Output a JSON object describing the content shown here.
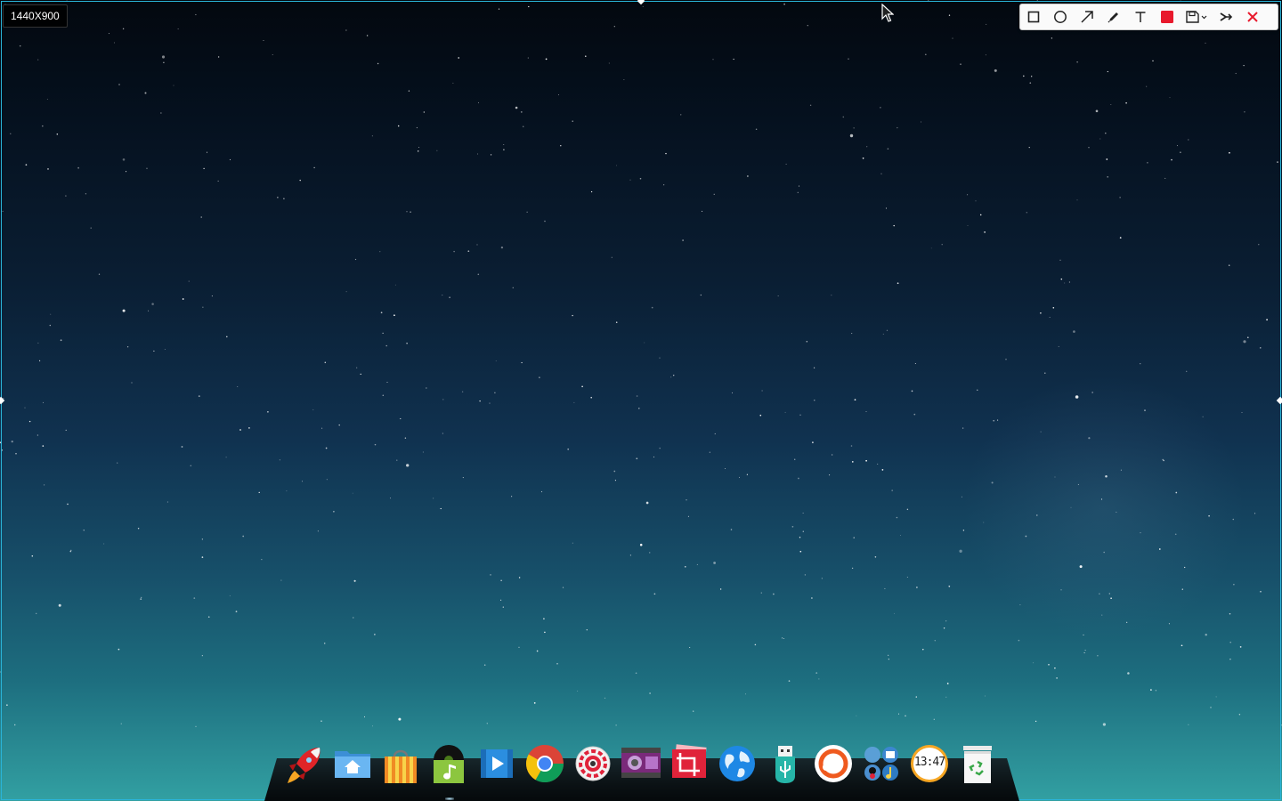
{
  "screenshot_tool": {
    "size_label": "1440X900",
    "accent_color": "#2ab4d8",
    "selected_color": "#e8192c",
    "tools": [
      {
        "name": "rectangle-tool",
        "icon": "square-outline-icon"
      },
      {
        "name": "ellipse-tool",
        "icon": "circle-outline-icon"
      },
      {
        "name": "arrow-tool",
        "icon": "arrow-diagonal-icon"
      },
      {
        "name": "pencil-tool",
        "icon": "pencil-icon"
      },
      {
        "name": "text-tool",
        "icon": "text-t-icon"
      },
      {
        "name": "color-picker",
        "icon": "color-swatch-red"
      },
      {
        "name": "save-tool",
        "icon": "floppy-disk-icon"
      },
      {
        "name": "share-tool",
        "icon": "share-arrow-icon"
      },
      {
        "name": "close-tool",
        "icon": "close-x-icon"
      }
    ]
  },
  "dock": {
    "items": [
      {
        "name": "launcher",
        "icon": "rocket-icon"
      },
      {
        "name": "file-manager",
        "icon": "home-folder-icon"
      },
      {
        "name": "app-store",
        "icon": "shopping-bag-icon"
      },
      {
        "name": "music-player",
        "icon": "music-note-icon"
      },
      {
        "name": "video-player",
        "icon": "video-play-icon"
      },
      {
        "name": "chrome-browser",
        "icon": "chrome-icon"
      },
      {
        "name": "system-settings",
        "icon": "gear-icon"
      },
      {
        "name": "media-player",
        "icon": "film-strip-icon"
      },
      {
        "name": "screenshot",
        "icon": "crop-icon"
      },
      {
        "name": "web-browser",
        "icon": "globe-icon"
      },
      {
        "name": "usb-manager",
        "icon": "usb-icon"
      },
      {
        "name": "app-circle",
        "icon": "orange-ring-icon"
      },
      {
        "name": "app-group",
        "icon": "app-grid-icon"
      },
      {
        "name": "clock",
        "icon": "clock-icon",
        "time_text": "13:47"
      },
      {
        "name": "trash",
        "icon": "recycle-bin-icon"
      }
    ]
  }
}
